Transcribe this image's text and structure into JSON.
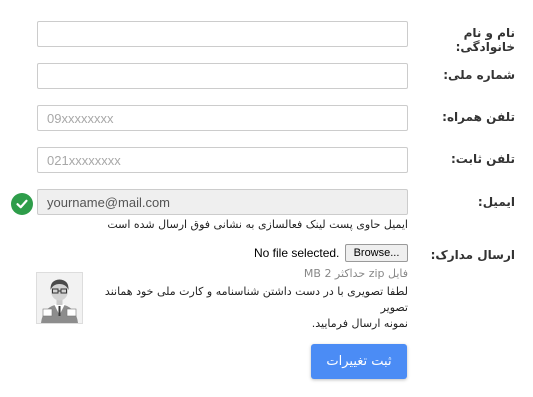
{
  "form": {
    "full_name": {
      "label": "نام و نام خانوادگی:",
      "value": "",
      "placeholder": ""
    },
    "national_id": {
      "label": "شماره ملی:",
      "value": "",
      "placeholder": ""
    },
    "mobile": {
      "label": "تلفن همراه:",
      "value": "",
      "placeholder": "09xxxxxxxx"
    },
    "landline": {
      "label": "تلفن ثابت:",
      "value": "",
      "placeholder": "021xxxxxxxx"
    },
    "email": {
      "label": "ایمیل:",
      "value": "yourname@mail.com",
      "hint": "ایمیل حاوی پست لینک فعالسازی به نشانی فوق ارسال شده است",
      "status_icon": "check-circle-icon",
      "status_color": "#2e9d4a"
    },
    "documents": {
      "label": "ارسال مدارک:",
      "browse_label": "Browse...",
      "file_status": "No file selected.",
      "limits": "فایل zip حداکثر 2 MB",
      "instructions_line1": "لطفا تصویری با در دست داشتن شناسنامه و کارت ملی خود همانند تصویر",
      "instructions_line2": "نمونه ارسال فرمایید.",
      "sample_image": "person-holding-id-card"
    },
    "submit_label": "ثبت تغییرات"
  },
  "colors": {
    "primary": "#4b8cf5",
    "success": "#2e9d4a",
    "border": "#cccccc"
  }
}
